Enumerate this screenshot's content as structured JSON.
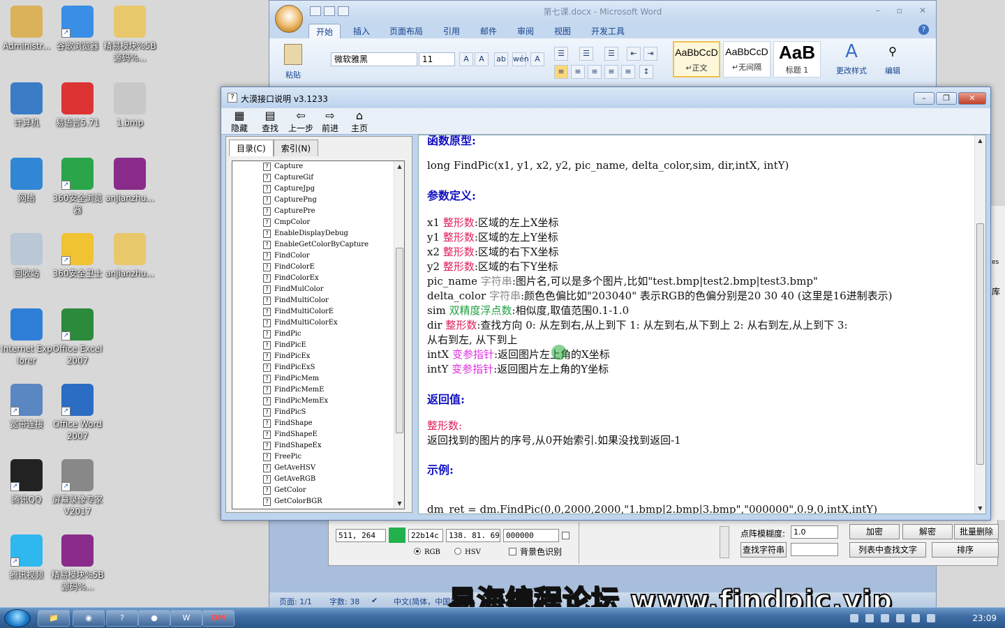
{
  "desktop": {
    "icons": [
      {
        "label": "Administr...",
        "icon": "user-folder-icon"
      },
      {
        "label": "谷歌浏览器",
        "icon": "chrome-icon"
      },
      {
        "label": "精易模块%5B源码%...",
        "icon": "folder-icon"
      },
      {
        "label": "计算机",
        "icon": "computer-icon"
      },
      {
        "label": "易语言5.71",
        "icon": "easylang-icon"
      },
      {
        "label": "1.bmp",
        "icon": "image-file-icon"
      },
      {
        "label": "网络",
        "icon": "network-icon"
      },
      {
        "label": "360安全浏览器",
        "icon": "browser-360-icon"
      },
      {
        "label": "anjianzhu...",
        "icon": "winrar-icon"
      },
      {
        "label": "回收站",
        "icon": "recycle-bin-icon"
      },
      {
        "label": "360安全卫士",
        "icon": "guard-360-icon"
      },
      {
        "label": "anjianzhu...",
        "icon": "folder-icon"
      },
      {
        "label": "Internet Explorer",
        "icon": "ie-icon"
      },
      {
        "label": "Office Excel 2007",
        "icon": "excel-icon"
      },
      {
        "label": "宽带连接",
        "icon": "broadband-icon"
      },
      {
        "label": "Office Word 2007",
        "icon": "word-icon"
      },
      {
        "label": "腾讯QQ",
        "icon": "qq-icon"
      },
      {
        "label": "屏幕录像专家V2017",
        "icon": "recorder-icon"
      },
      {
        "label": "腾讯视频",
        "icon": "tencent-video-icon"
      },
      {
        "label": "精易模块%5B源码%...",
        "icon": "winrar-icon"
      }
    ]
  },
  "word": {
    "title": "第七课.docx - Microsoft Word",
    "tabs": [
      "开始",
      "插入",
      "页面布局",
      "引用",
      "邮件",
      "审阅",
      "视图",
      "开发工具"
    ],
    "paste_label": "粘贴",
    "font_name": "微软雅黑",
    "font_size": "11",
    "styles": [
      {
        "sample": "AaBbCcD",
        "name": "↵正文"
      },
      {
        "sample": "AaBbCcD",
        "name": "↵无间隔"
      },
      {
        "sample": "AaB",
        "name": "标题 1"
      }
    ],
    "change_styles": "更改样式",
    "edit": "编辑",
    "status": {
      "page": "页面: 1/1",
      "words": "字数: 38",
      "lang": "中文(简体，中国)"
    }
  },
  "tool": {
    "coord": "511, 264",
    "hex": "22b14c",
    "rgb_text": "138. 81. 69",
    "offset": "000000",
    "radio_rgb": "RGB",
    "radio_hsv": "HSV",
    "bg_check": "背景色识别",
    "fuzzy_label": "点阵模糊度:",
    "fuzzy_value": "1.0",
    "find_str_btn": "查找字符串",
    "encrypt": "加密",
    "decrypt": "解密",
    "batch_delete": "批量删除",
    "list_find": "列表中查找文字",
    "sort": "排序",
    "accent": "#22b14c"
  },
  "right_pane": {
    "text1": "es",
    "text2": "库"
  },
  "help": {
    "title": "大漠接口说明 v3.1233",
    "toolbar": [
      "隐藏",
      "查找",
      "上一步",
      "前进",
      "主页"
    ],
    "tabs": [
      "目录(C)",
      "索引(N)"
    ],
    "functions": [
      "Capture",
      "CaptureGif",
      "CaptureJpg",
      "CapturePng",
      "CapturePre",
      "CmpColor",
      "EnableDisplayDebug",
      "EnableGetColorByCapture",
      "FindColor",
      "FindColorE",
      "FindColorEx",
      "FindMulColor",
      "FindMultiColor",
      "FindMultiColorE",
      "FindMultiColorEx",
      "FindPic",
      "FindPicE",
      "FindPicEx",
      "FindPicExS",
      "FindPicMem",
      "FindPicMemE",
      "FindPicMemEx",
      "FindPicS",
      "FindShape",
      "FindShapeE",
      "FindShapeEx",
      "FreePic",
      "GetAveHSV",
      "GetAveRGB",
      "GetColor",
      "GetColorBGR"
    ],
    "content": {
      "proto_heading": "函数原型:",
      "prototype": "long FindPic(x1, y1, x2, y2, pic_name, delta_color,sim, dir,intX, intY)",
      "params_heading": "参数定义:",
      "params": [
        {
          "name": "x1",
          "type": "整形数",
          "desc": ":区域的左上X坐标",
          "color": "#e0205a"
        },
        {
          "name": "y1",
          "type": "整形数",
          "desc": ":区域的左上Y坐标",
          "color": "#e0205a"
        },
        {
          "name": "x2",
          "type": "整形数",
          "desc": ":区域的右下X坐标",
          "color": "#e0205a"
        },
        {
          "name": "y2",
          "type": "整形数",
          "desc": ":区域的右下Y坐标",
          "color": "#e0205a"
        },
        {
          "name": "pic_name",
          "type": "字符串",
          "desc": ":图片名,可以是多个图片,比如\"test.bmp|test2.bmp|test3.bmp\"",
          "color": "#8a8a8a"
        },
        {
          "name": "delta_color",
          "type": "字符串",
          "desc": ":颜色色偏比如\"203040\" 表示RGB的色偏分别是20 30 40 (这里是16进制表示)",
          "color": "#8a8a8a"
        },
        {
          "name": "sim",
          "type": "双精度浮点数",
          "desc": ":相似度,取值范围0.1-1.0",
          "color": "#20a040"
        },
        {
          "name": "dir",
          "type": "整形数",
          "desc": ":查找方向 0: 从左到右,从上到下 1: 从左到右,从下到上 2: 从右到左,从上到下 3:",
          "color": "#e0205a"
        },
        {
          "name": "",
          "type": "",
          "desc": "从右到左,  从下到上",
          "color": "#e0205a"
        },
        {
          "name": "intX",
          "type": "变参指针",
          "desc": ":返回图片左上角的X坐标",
          "color": "#e030e0"
        },
        {
          "name": "intY",
          "type": "变参指针",
          "desc": ":返回图片左上角的Y坐标",
          "color": "#e030e0"
        }
      ],
      "return_heading": "返回值:",
      "return_type": "整形数:",
      "return_desc": "返回找到的图片的序号,从0开始索引.如果没找到返回-1",
      "example_heading": "示例:",
      "example": "dm_ret = dm.FindPic(0,0,2000,2000,\"1.bmp|2.bmp|3.bmp\",\"000000\",0.9,0,intX,intY)"
    }
  },
  "watermark": "易海编程论坛 www.findpic.vip",
  "taskbar": {
    "items": [
      "explorer-icon",
      "browser-icon",
      "notes-icon",
      "app-icon",
      "word-icon",
      "dm-icon"
    ],
    "dm_label": "DM",
    "clock": "23:09"
  }
}
